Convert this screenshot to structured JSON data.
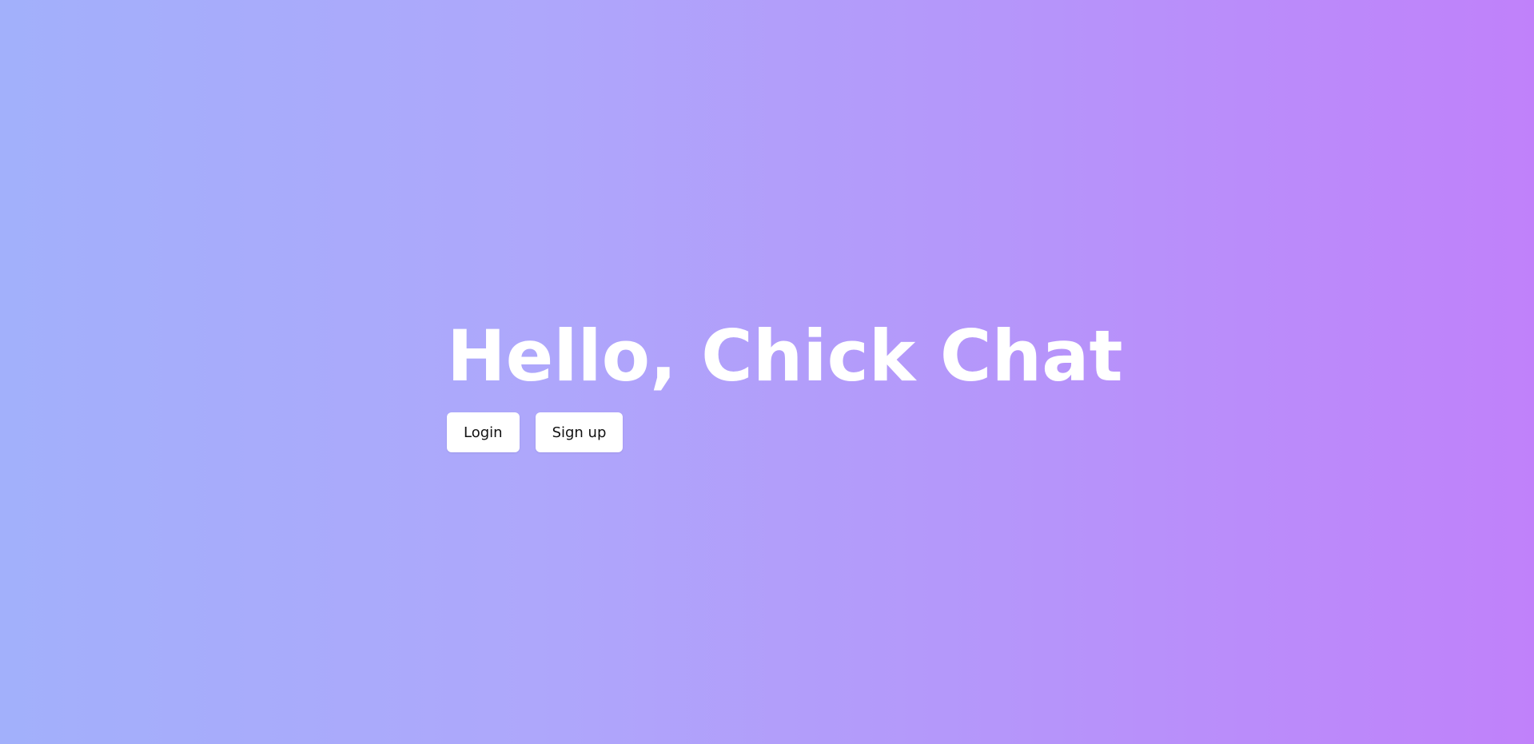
{
  "hero": {
    "title": "Hello, Chick Chat"
  },
  "actions": {
    "login_label": "Login",
    "signup_label": "Sign up"
  },
  "colors": {
    "gradient_start": "#a2b0fb",
    "gradient_end": "#c081fa",
    "title_color": "#ffffff",
    "button_bg": "#ffffff",
    "button_text": "#111111"
  }
}
